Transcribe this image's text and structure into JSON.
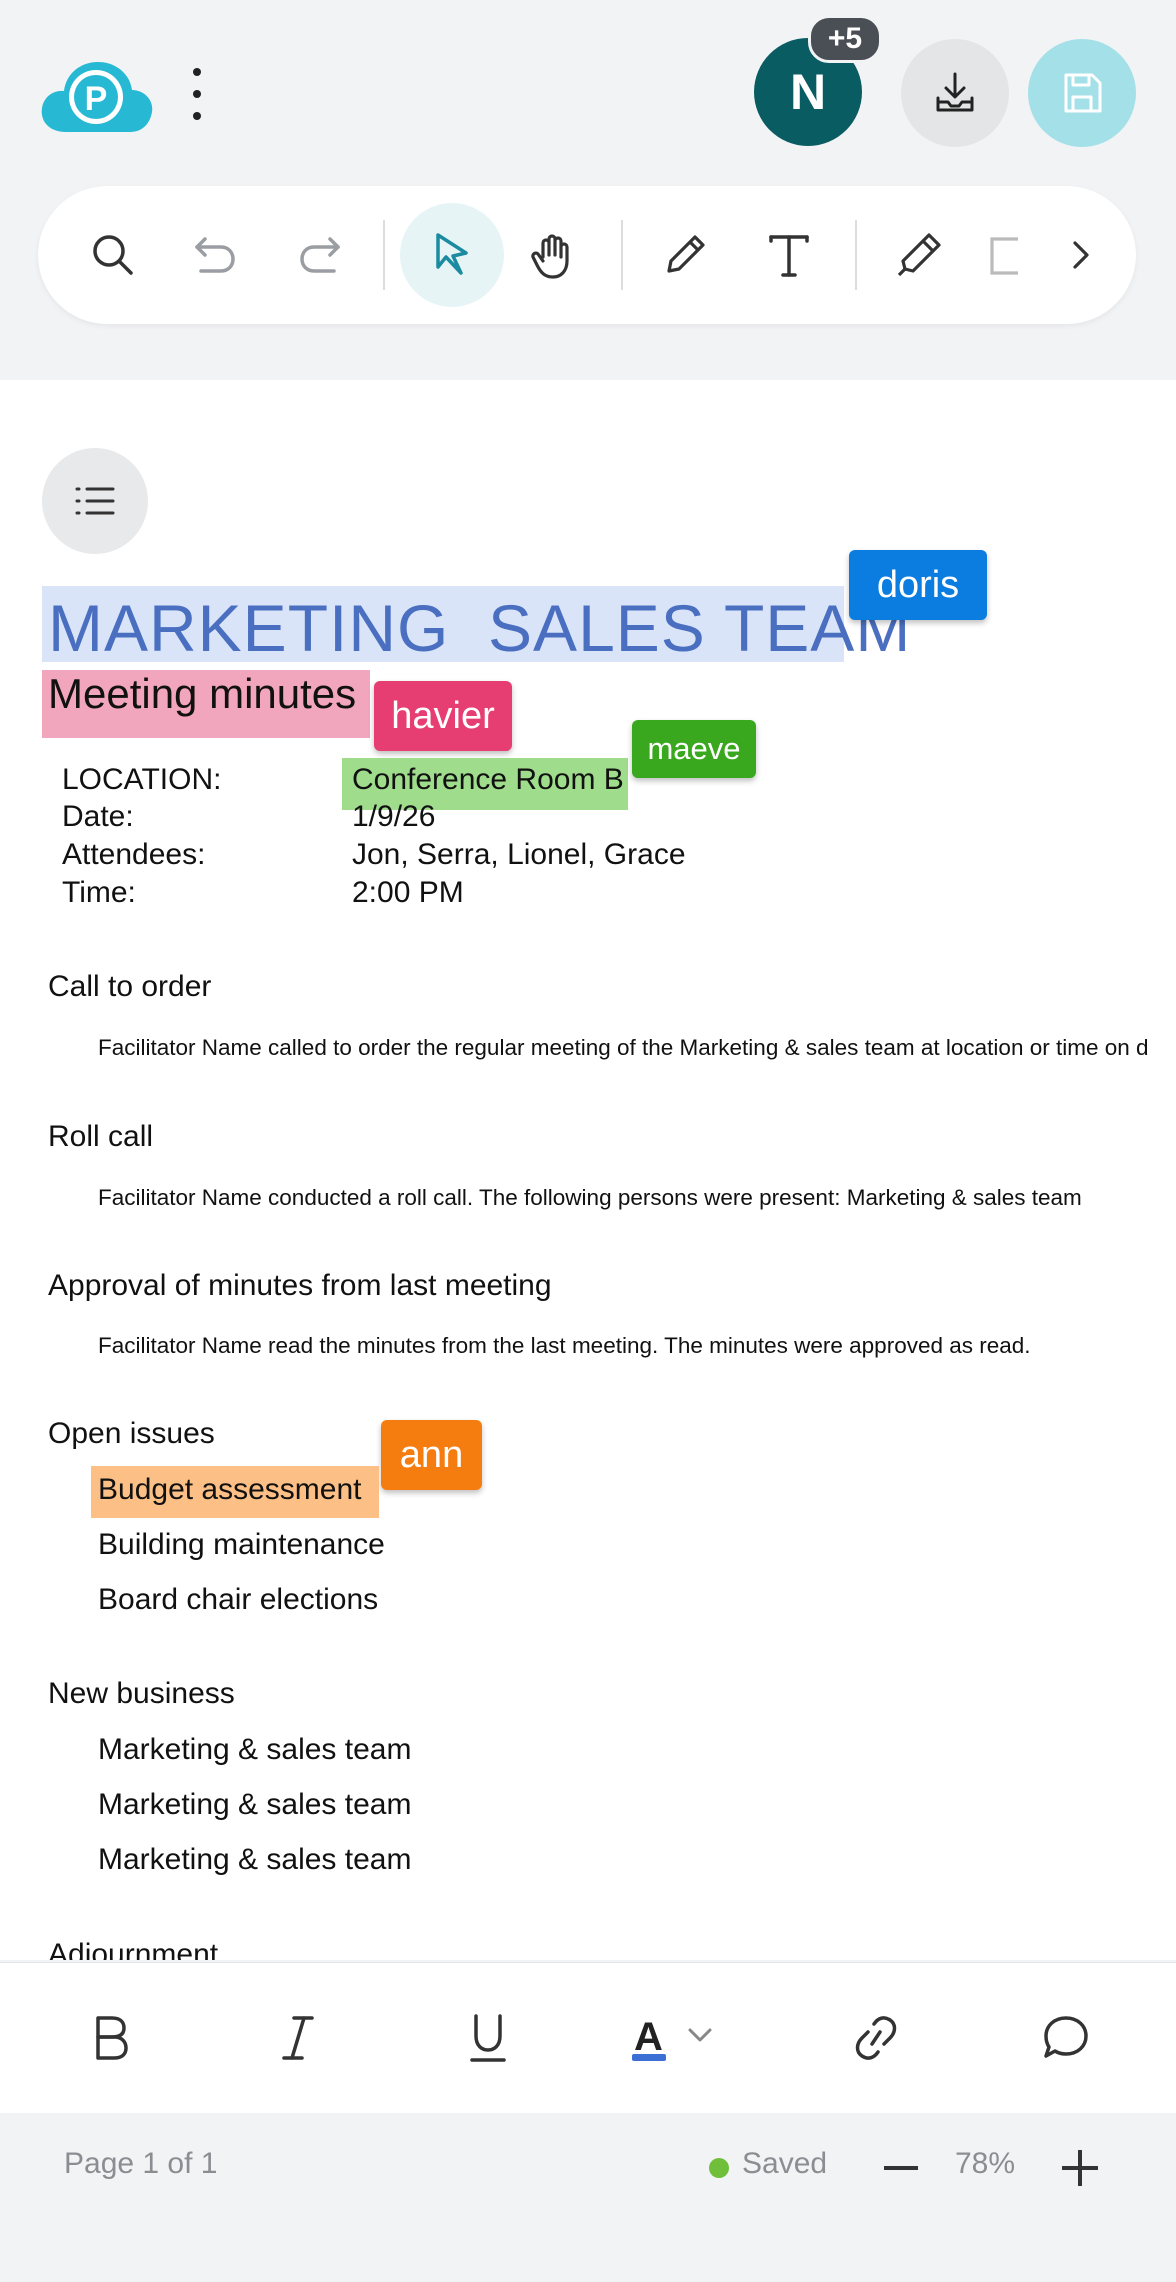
{
  "header": {
    "collaborators_badge": "+5",
    "avatar_initial": "N"
  },
  "toolbar": {
    "tools": [
      "search-icon",
      "undo-icon",
      "redo-icon",
      "select-pointer-icon",
      "pan-hand-icon",
      "pen-icon",
      "text-icon",
      "highlighter-icon",
      "shape-icon",
      "chevron-right-icon"
    ],
    "active_tool": "select-pointer-icon"
  },
  "document": {
    "title": "MARKETING  SALES TEAM",
    "subtitle": "Meeting minutes",
    "meta": [
      {
        "label": "LOCATION:",
        "value": "Conference Room B"
      },
      {
        "label": "Date:",
        "value": "1/9/26"
      },
      {
        "label": "Attendees:",
        "value": "Jon, Serra, Lionel, Grace"
      },
      {
        "label": "Time:",
        "value": "2:00 PM"
      }
    ],
    "sections": {
      "call_to_order": {
        "heading": "Call to order",
        "text": "Facilitator Name called to order the regular meeting of the Marketing & sales team at location or time on d"
      },
      "roll_call": {
        "heading": "Roll call",
        "text": "Facilitator Name conducted a roll call. The following persons were present: Marketing & sales team"
      },
      "approval": {
        "heading": "Approval of minutes from last meeting",
        "text": "Facilitator Name read the minutes from the last meeting. The minutes were approved as read."
      },
      "open_issues": {
        "heading": "Open issues",
        "items": [
          "Budget assessment",
          "Building maintenance",
          "Board chair elections"
        ]
      },
      "new_business": {
        "heading": "New business",
        "items": [
          "Marketing & sales team",
          "Marketing & sales team",
          "Marketing & sales team"
        ]
      },
      "adjournment": {
        "heading": "Adjournment"
      }
    },
    "cursors": {
      "doris": {
        "name": "doris",
        "color": "#0b7de0"
      },
      "havier": {
        "name": "havier",
        "color": "#e63e72"
      },
      "maeve": {
        "name": "maeve",
        "color": "#3aa81e"
      },
      "ann": {
        "name": "ann",
        "color": "#f57c0f"
      }
    }
  },
  "format_bar": {
    "buttons": [
      "bold-icon",
      "italic-icon",
      "underline-icon",
      "text-color-icon",
      "link-icon",
      "comment-icon"
    ],
    "text_color": "#3b6fd4"
  },
  "status": {
    "page_indicator": "Page 1 of 1",
    "save_state": "Saved",
    "zoom": "78%"
  }
}
